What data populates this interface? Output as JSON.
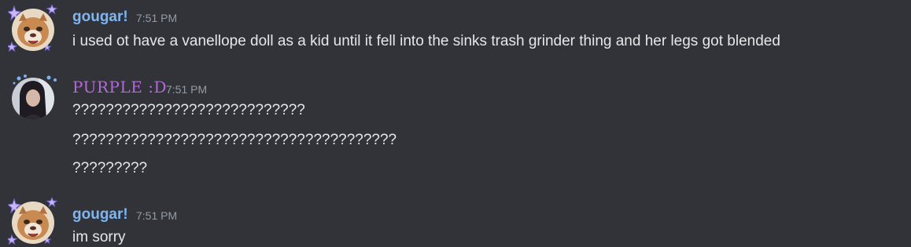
{
  "colors": {
    "background": "#313338",
    "gougar_name": "#7fb6f2",
    "purple_name": "#b36ad9",
    "timestamp": "#949ba4",
    "text": "#e6e7e9"
  },
  "messages": [
    {
      "author": "gougar!",
      "time": "7:51 PM",
      "avatar_icon": "cougar-avatar-icon",
      "lines": [
        "i used ot have a vanellope doll as a kid until it fell into the sinks trash grinder thing and her legs got blended"
      ]
    },
    {
      "author": "PURPLE :D",
      "time": "7:51 PM",
      "avatar_icon": "dark-haired-avatar-icon",
      "lines": [
        "????????????????????????????",
        "???????????????????????????????????????",
        "?????????"
      ]
    },
    {
      "author": "gougar!",
      "time": "7:51 PM",
      "avatar_icon": "cougar-avatar-icon",
      "lines": [
        "im sorry"
      ]
    }
  ]
}
